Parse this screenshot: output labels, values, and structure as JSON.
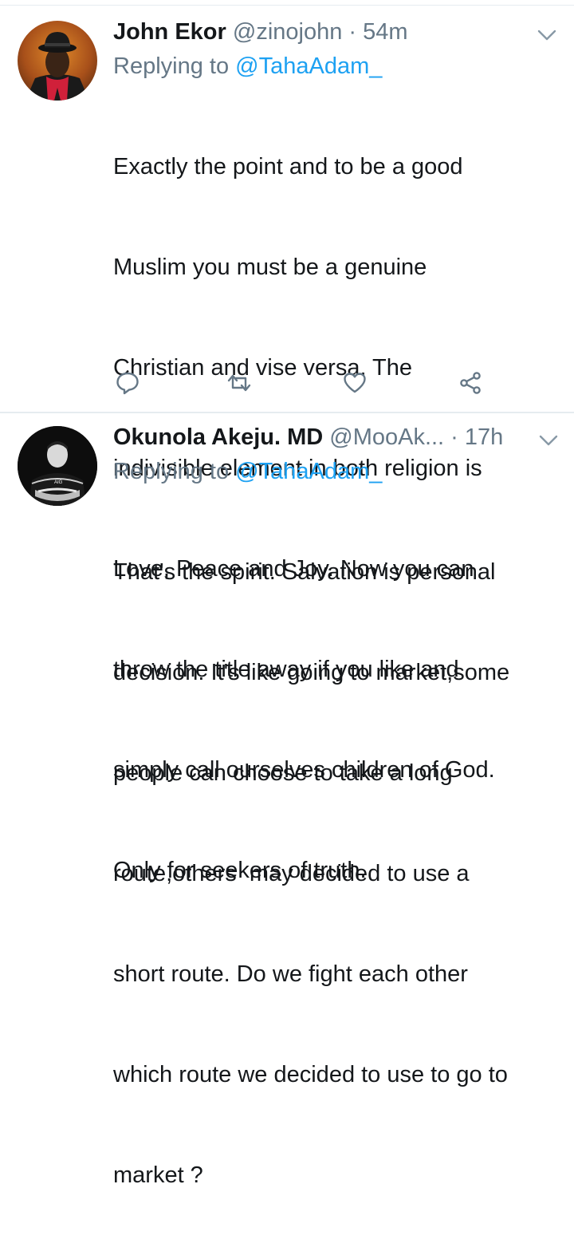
{
  "tweets": [
    {
      "display_name": "John Ekor",
      "handle": "@zinojohn",
      "separator": " · ",
      "time": "54m",
      "replying_prefix": "Replying to ",
      "replying_to": "@TahaAdam_",
      "text_lines": [
        "Exactly the point and to be a good",
        "Muslim you must be a genuine",
        "Christian and vise versa. The",
        "indivisible element in both religion is",
        "Love, Peace and Joy. Now you can",
        "throw the title away if you like and",
        "simply call ourselves children of God.",
        "Only for seekers of truth."
      ],
      "actions": [
        "reply-icon",
        "retweet-icon",
        "like-icon",
        "share-icon"
      ]
    },
    {
      "display_name": "Okunola Akeju. MD",
      "handle": "@MooAk...",
      "separator": " · ",
      "time": "17h",
      "replying_prefix": "Replying to ",
      "replying_to": "@TahaAdam_",
      "text_lines": [
        "That's the spirit. Salvation is personal",
        "decision. It's like going to market,some",
        "people can choose to take a long",
        "route,others  may decided to use a",
        "short route. Do we fight each other",
        "which route we decided to use to go to",
        "market ?"
      ]
    }
  ],
  "colors": {
    "link": "#1da1f2",
    "meta": "#657786",
    "text": "#14171a",
    "divider": "#e6ecf0"
  }
}
